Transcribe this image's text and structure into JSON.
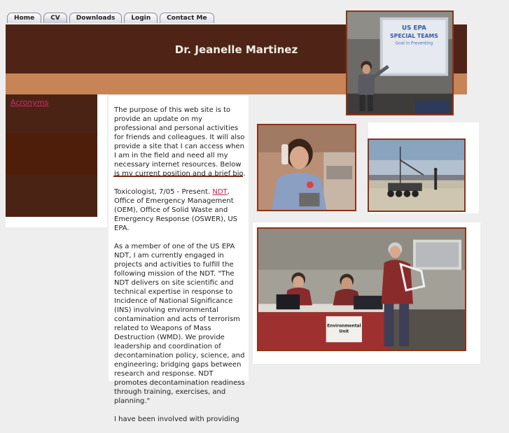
{
  "tabs": [
    "Home",
    "CV",
    "Downloads",
    "Login",
    "Contact Me"
  ],
  "active_tab": "CV",
  "site_title": "Dr. Jeanelle Martinez",
  "nav": {
    "acronyms": "Acronyms"
  },
  "content": {
    "intro": "The purpose of this web site is to provide an update on my professional and personal activities for friends and colleagues. It will also provide a site that I can access when I am in the field and need all my necessary internet resources. Below is my current position and a brief bio.",
    "position_prefix": "Toxicologist, 7/05 - Present.",
    "position_link": "NDT",
    "position_suffix": ", Office of Emergency Management (OEM), Office of Solid Waste and Emergency Response (OSWER), US EPA.",
    "mission": "As a member of one of the US EPA NDT, I am currently engaged in projects and activities to fulfill the following mission of the NDT. \"The NDT delivers on site scientific and technical expertise in response to Incidence of National Significance (INS) involving environmental contamination and acts of terrorism related to Weapons of Mass Destruction (WMD). We provide leadership and coordination of decontamination policy, science, and engineering; bridging gaps between research and response. NDT promotes decontamination readiness through training, exercises, and planning.\"",
    "involvement": "I have been involved with providing"
  },
  "photos": {
    "slide_line1": "US EPA",
    "slide_line2": "SPECIAL TEAMS",
    "slide_line3": "Goal in Preventing",
    "sign_line1": "Environmental",
    "sign_line2": "Unit"
  }
}
